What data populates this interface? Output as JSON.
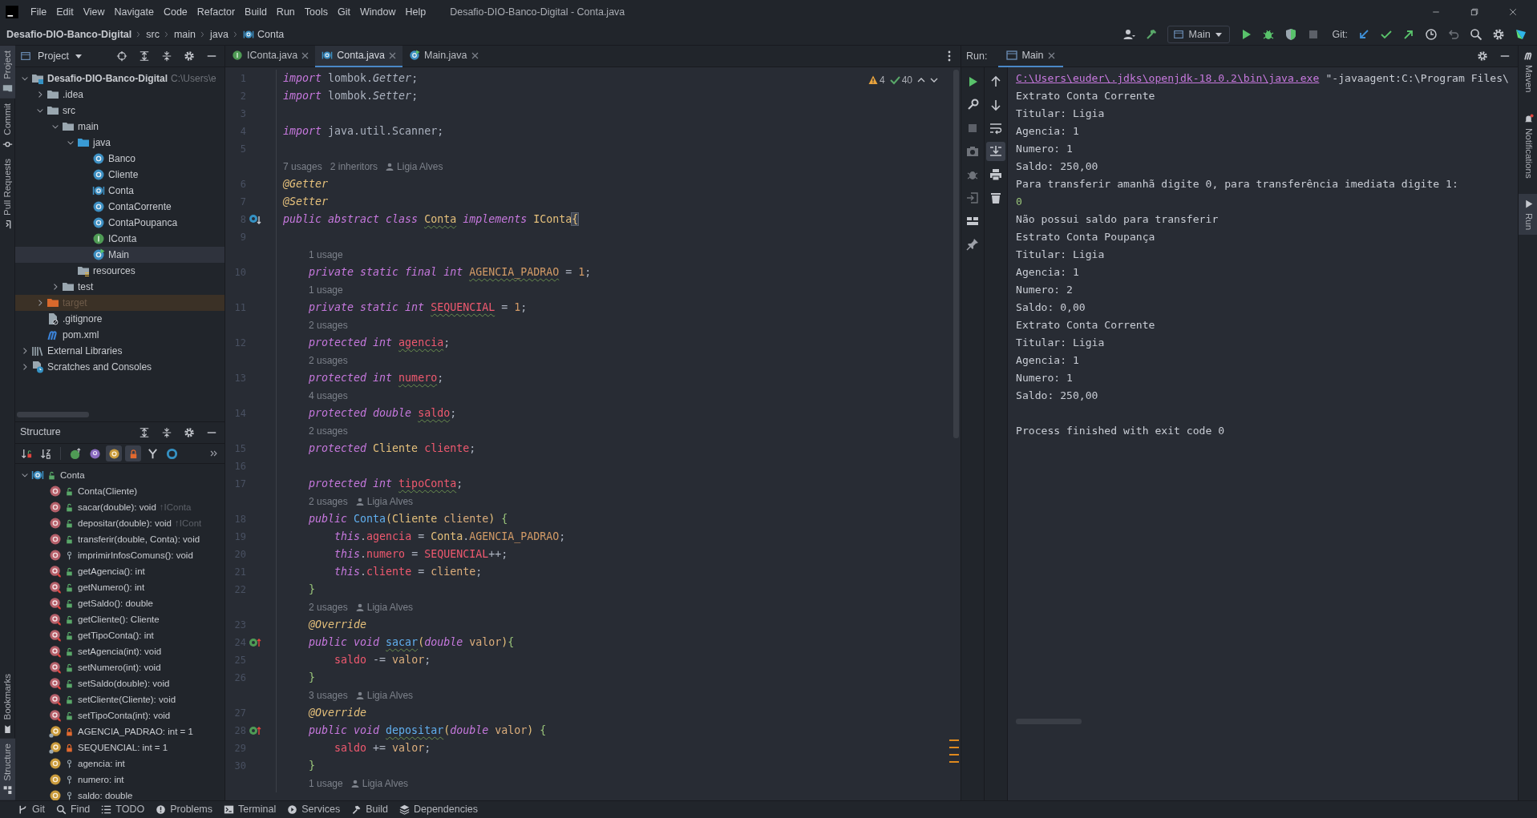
{
  "window": {
    "title": "Desafio-DIO-Banco-Digital - Conta.java"
  },
  "menu": [
    "File",
    "Edit",
    "View",
    "Navigate",
    "Code",
    "Refactor",
    "Build",
    "Run",
    "Tools",
    "Git",
    "Window",
    "Help"
  ],
  "breadcrumb": [
    {
      "label": "Desafio-DIO-Banco-Digital",
      "kind": "project"
    },
    {
      "label": "src",
      "kind": "plain"
    },
    {
      "label": "main",
      "kind": "plain"
    },
    {
      "label": "java",
      "kind": "plain"
    },
    {
      "label": "Conta",
      "kind": "abstract"
    }
  ],
  "toolbar": {
    "run_config": "Main",
    "git_label": "Git:"
  },
  "left_strip": {
    "top": [
      {
        "label": "Project",
        "kind": "project",
        "selected": true
      },
      {
        "label": "Commit",
        "kind": "commit",
        "selected": false
      },
      {
        "label": "Pull Requests",
        "kind": "pullrequests",
        "selected": false
      }
    ],
    "bottom": [
      {
        "label": "Bookmarks",
        "kind": "bookmarks",
        "selected": false
      },
      {
        "label": "Structure",
        "kind": "structure",
        "selected": true
      }
    ]
  },
  "project": {
    "title": "Project",
    "tree": [
      {
        "label": "Desafio-DIO-Banco-Digital",
        "kind": "module",
        "note": "C:\\Users\\e",
        "expanded": true,
        "selected": false,
        "children": [
          {
            "label": ".idea",
            "kind": "folder",
            "expanded": false,
            "selected": false
          },
          {
            "label": "src",
            "kind": "folder",
            "expanded": true,
            "selected": false,
            "children": [
              {
                "label": "main",
                "kind": "folder",
                "expanded": true,
                "selected": false,
                "children": [
                  {
                    "label": "java",
                    "kind": "source",
                    "expanded": true,
                    "selected": false,
                    "children": [
                      {
                        "label": "Banco",
                        "kind": "class",
                        "selected": false
                      },
                      {
                        "label": "Cliente",
                        "kind": "class",
                        "selected": false
                      },
                      {
                        "label": "Conta",
                        "kind": "abstract",
                        "selected": false
                      },
                      {
                        "label": "ContaCorrente",
                        "kind": "class",
                        "selected": false
                      },
                      {
                        "label": "ContaPoupanca",
                        "kind": "class",
                        "selected": false
                      },
                      {
                        "label": "IConta",
                        "kind": "interface",
                        "selected": false
                      },
                      {
                        "label": "Main",
                        "kind": "main",
                        "selected": true
                      }
                    ]
                  },
                  {
                    "label": "resources",
                    "kind": "resources",
                    "selected": false
                  }
                ]
              },
              {
                "label": "test",
                "kind": "folder",
                "expanded": false,
                "selected": false
              }
            ]
          },
          {
            "label": "target",
            "kind": "excluded",
            "expanded": false,
            "selected": false
          },
          {
            "label": ".gitignore",
            "kind": "ignore",
            "selected": false
          },
          {
            "label": "pom.xml",
            "kind": "maven",
            "selected": false
          }
        ]
      },
      {
        "label": "External Libraries",
        "kind": "libraries",
        "expanded": false,
        "selected": false
      },
      {
        "label": "Scratches and Consoles",
        "kind": "scratches",
        "expanded": false,
        "selected": false
      }
    ]
  },
  "structure": {
    "title": "Structure",
    "toolbar": [
      {
        "kind": "visibility",
        "on": false
      },
      {
        "kind": "alpha",
        "on": false
      },
      {
        "kind": "inherited",
        "on": false
      },
      {
        "kind": "properties",
        "on": false
      },
      {
        "kind": "fields",
        "on": true
      },
      {
        "kind": "nonpublic",
        "on": true
      },
      {
        "kind": "lambdas",
        "on": false
      },
      {
        "kind": "anonymous",
        "on": false
      }
    ],
    "tree": [
      {
        "label": "Conta",
        "kind": "publicabstract",
        "expanded": true,
        "selected": false,
        "children": [
          {
            "label": "Conta(Cliente)",
            "kind": "publicmethod",
            "selected": false
          },
          {
            "label": "sacar(double): void",
            "suffix": "↑IConta",
            "kind": "publicmethod",
            "selected": false
          },
          {
            "label": "depositar(double): void",
            "suffix": "↑ICont",
            "kind": "publicmethod",
            "selected": false
          },
          {
            "label": "transferir(double, Conta): void",
            "kind": "publicmethod",
            "selected": false
          },
          {
            "label": "imprimirInfosComuns(): void",
            "kind": "protectedmethod",
            "selected": false
          },
          {
            "label": "getAgencia(): int",
            "kind": "publiclombok",
            "selected": false
          },
          {
            "label": "getNumero(): int",
            "kind": "publiclombok",
            "selected": false
          },
          {
            "label": "getSaldo(): double",
            "kind": "publiclombok",
            "selected": false
          },
          {
            "label": "getCliente(): Cliente",
            "kind": "publiclombok",
            "selected": false
          },
          {
            "label": "getTipoConta(): int",
            "kind": "publiclombok",
            "selected": false
          },
          {
            "label": "setAgencia(int): void",
            "kind": "publiclombok",
            "selected": false
          },
          {
            "label": "setNumero(int): void",
            "kind": "publiclombok",
            "selected": false
          },
          {
            "label": "setSaldo(double): void",
            "kind": "publiclombok",
            "selected": false
          },
          {
            "label": "setCliente(Cliente): void",
            "kind": "publiclombok",
            "selected": false
          },
          {
            "label": "setTipoConta(int): void",
            "kind": "publiclombok",
            "selected": false
          },
          {
            "label": "AGENCIA_PADRAO: int = 1",
            "kind": "privatestatic",
            "selected": false
          },
          {
            "label": "SEQUENCIAL: int = 1",
            "kind": "privatestatic",
            "selected": false
          },
          {
            "label": "agencia: int",
            "kind": "protectedfield",
            "selected": false
          },
          {
            "label": "numero: int",
            "kind": "protectedfield",
            "selected": false
          },
          {
            "label": "saldo: double",
            "kind": "protectedfield",
            "selected": false
          }
        ]
      }
    ]
  },
  "editor": {
    "tabs": [
      {
        "label": "IConta.java",
        "kind": "interface",
        "selected": false
      },
      {
        "label": "Conta.java",
        "kind": "abstract",
        "selected": true
      },
      {
        "label": "Main.java",
        "kind": "main",
        "selected": false
      }
    ],
    "inspection": {
      "warnings": "4",
      "weak_warnings": "40"
    },
    "lines": [
      {
        "kind": "code",
        "number": "1",
        "tokens": [
          {
            "kind": "kw",
            "text": "import"
          },
          {
            "kind": "txt",
            "text": " lombok."
          },
          {
            "kind": "it",
            "text": "Getter"
          },
          {
            "kind": "txt",
            "text": ";"
          }
        ]
      },
      {
        "kind": "code",
        "number": "2",
        "tokens": [
          {
            "kind": "kw",
            "text": "import"
          },
          {
            "kind": "txt",
            "text": " lombok."
          },
          {
            "kind": "it",
            "text": "Setter"
          },
          {
            "kind": "txt",
            "text": ";"
          }
        ]
      },
      {
        "kind": "code",
        "number": "3"
      },
      {
        "kind": "code",
        "number": "4",
        "tokens": [
          {
            "kind": "kw",
            "text": "import"
          },
          {
            "kind": "txt",
            "text": " java.util.Scanner;"
          }
        ]
      },
      {
        "kind": "code",
        "number": "5"
      },
      {
        "kind": "hint",
        "hints": [
          "7 usages",
          "2 inheritors"
        ],
        "author": "Ligia Alves"
      },
      {
        "kind": "code",
        "number": "6",
        "tokens": [
          {
            "kind": "ann",
            "text": "@Getter"
          }
        ]
      },
      {
        "kind": "code",
        "number": "7",
        "tokens": [
          {
            "kind": "ann",
            "text": "@Setter"
          }
        ]
      },
      {
        "kind": "code",
        "number": "8",
        "implemented": true,
        "tokens": [
          {
            "kind": "kw",
            "text": "public abstract class "
          },
          {
            "kind": "clsw",
            "text": "Conta"
          },
          {
            "kind": "kw",
            "text": " implements "
          },
          {
            "kind": "cls",
            "text": "IConta"
          },
          {
            "kind": "brh",
            "text": "{"
          }
        ]
      },
      {
        "kind": "code",
        "number": "9"
      },
      {
        "kind": "hint",
        "hints": [
          "1 usage"
        ]
      },
      {
        "kind": "code",
        "number": "10",
        "tokens": [
          {
            "kind": "kw",
            "text": "    private static final int "
          },
          {
            "kind": "cstw",
            "text": "AGENCIA_PADRAO"
          },
          {
            "kind": "txt",
            "text": " = "
          },
          {
            "kind": "num",
            "text": "1"
          },
          {
            "kind": "txt",
            "text": ";"
          }
        ]
      },
      {
        "kind": "hint",
        "hints": [
          "1 usage"
        ]
      },
      {
        "kind": "code",
        "number": "11",
        "tokens": [
          {
            "kind": "kw",
            "text": "    private static int "
          },
          {
            "kind": "fldw",
            "text": "SEQUENCIAL"
          },
          {
            "kind": "txt",
            "text": " = "
          },
          {
            "kind": "num",
            "text": "1"
          },
          {
            "kind": "txt",
            "text": ";"
          }
        ]
      },
      {
        "kind": "hint",
        "hints": [
          "2 usages"
        ]
      },
      {
        "kind": "code",
        "number": "12",
        "tokens": [
          {
            "kind": "kw",
            "text": "    protected int "
          },
          {
            "kind": "fldw",
            "text": "agencia"
          },
          {
            "kind": "txt",
            "text": ";"
          }
        ]
      },
      {
        "kind": "hint",
        "hints": [
          "2 usages"
        ]
      },
      {
        "kind": "code",
        "number": "13",
        "tokens": [
          {
            "kind": "kw",
            "text": "    protected int "
          },
          {
            "kind": "fldw",
            "text": "numero"
          },
          {
            "kind": "txt",
            "text": ";"
          }
        ]
      },
      {
        "kind": "hint",
        "hints": [
          "4 usages"
        ]
      },
      {
        "kind": "code",
        "number": "14",
        "tokens": [
          {
            "kind": "kw",
            "text": "    protected double "
          },
          {
            "kind": "fldw",
            "text": "saldo"
          },
          {
            "kind": "txt",
            "text": ";"
          }
        ]
      },
      {
        "kind": "hint",
        "hints": [
          "2 usages"
        ]
      },
      {
        "kind": "code",
        "number": "15",
        "tokens": [
          {
            "kind": "kw",
            "text": "    protected "
          },
          {
            "kind": "cls",
            "text": "Cliente "
          },
          {
            "kind": "fld",
            "text": "cliente"
          },
          {
            "kind": "txt",
            "text": ";"
          }
        ]
      },
      {
        "kind": "code",
        "number": "16"
      },
      {
        "kind": "code",
        "number": "17",
        "tokens": [
          {
            "kind": "kw",
            "text": "    protected int "
          },
          {
            "kind": "fldw",
            "text": "tipoConta"
          },
          {
            "kind": "txt",
            "text": ";"
          }
        ]
      },
      {
        "kind": "hint",
        "hints": [
          "2 usages"
        ],
        "author": "Ligia Alves"
      },
      {
        "kind": "code",
        "number": "18",
        "tokens": [
          {
            "kind": "kw",
            "text": "    public "
          },
          {
            "kind": "fn",
            "text": "Conta"
          },
          {
            "kind": "par",
            "text": "("
          },
          {
            "kind": "cls",
            "text": "Cliente "
          },
          {
            "kind": "prm",
            "text": "cliente"
          },
          {
            "kind": "par",
            "text": ")"
          },
          {
            "kind": "brc",
            "text": " {"
          }
        ]
      },
      {
        "kind": "code",
        "number": "19",
        "tokens": [
          {
            "kind": "kw",
            "text": "        this"
          },
          {
            "kind": "txt",
            "text": "."
          },
          {
            "kind": "fld",
            "text": "agencia"
          },
          {
            "kind": "txt",
            "text": " = "
          },
          {
            "kind": "cls",
            "text": "Conta"
          },
          {
            "kind": "txt",
            "text": "."
          },
          {
            "kind": "cst",
            "text": "AGENCIA_PADRAO"
          },
          {
            "kind": "txt",
            "text": ";"
          }
        ]
      },
      {
        "kind": "code",
        "number": "20",
        "tokens": [
          {
            "kind": "kw",
            "text": "        this"
          },
          {
            "kind": "txt",
            "text": "."
          },
          {
            "kind": "fld",
            "text": "numero"
          },
          {
            "kind": "txt",
            "text": " = "
          },
          {
            "kind": "fld",
            "text": "SEQUENCIAL"
          },
          {
            "kind": "txt",
            "text": "++;"
          }
        ]
      },
      {
        "kind": "code",
        "number": "21",
        "tokens": [
          {
            "kind": "kw",
            "text": "        this"
          },
          {
            "kind": "txt",
            "text": "."
          },
          {
            "kind": "fld",
            "text": "cliente"
          },
          {
            "kind": "txt",
            "text": " = "
          },
          {
            "kind": "prm",
            "text": "cliente"
          },
          {
            "kind": "txt",
            "text": ";"
          }
        ]
      },
      {
        "kind": "code",
        "number": "22",
        "tokens": [
          {
            "kind": "brc",
            "text": "    }"
          }
        ]
      },
      {
        "kind": "hint",
        "hints": [
          "2 usages"
        ],
        "author": "Ligia Alves"
      },
      {
        "kind": "code",
        "number": "23",
        "tokens": [
          {
            "kind": "ann",
            "text": "    @Override"
          }
        ]
      },
      {
        "kind": "code",
        "number": "24",
        "overrides": true,
        "tokens": [
          {
            "kind": "kw",
            "text": "    public void "
          },
          {
            "kind": "fnw",
            "text": "sacar"
          },
          {
            "kind": "par",
            "text": "("
          },
          {
            "kind": "kw",
            "text": "double "
          },
          {
            "kind": "prm",
            "text": "valor"
          },
          {
            "kind": "par",
            "text": ")"
          },
          {
            "kind": "brc",
            "text": "{"
          }
        ]
      },
      {
        "kind": "code",
        "number": "25",
        "tokens": [
          {
            "kind": "fld",
            "text": "        saldo"
          },
          {
            "kind": "txt",
            "text": " -= "
          },
          {
            "kind": "prm",
            "text": "valor"
          },
          {
            "kind": "txt",
            "text": ";"
          }
        ]
      },
      {
        "kind": "code",
        "number": "26",
        "tokens": [
          {
            "kind": "brc",
            "text": "    }"
          }
        ]
      },
      {
        "kind": "hint",
        "hints": [
          "3 usages"
        ],
        "author": "Ligia Alves"
      },
      {
        "kind": "code",
        "number": "27",
        "tokens": [
          {
            "kind": "ann",
            "text": "    @Override"
          }
        ]
      },
      {
        "kind": "code",
        "number": "28",
        "overrides": true,
        "tokens": [
          {
            "kind": "kw",
            "text": "    public void "
          },
          {
            "kind": "fnw",
            "text": "depositar"
          },
          {
            "kind": "par",
            "text": "("
          },
          {
            "kind": "kw",
            "text": "double "
          },
          {
            "kind": "prm",
            "text": "valor"
          },
          {
            "kind": "par",
            "text": ")"
          },
          {
            "kind": "brc",
            "text": " {"
          }
        ]
      },
      {
        "kind": "code",
        "number": "29",
        "tokens": [
          {
            "kind": "fld",
            "text": "        saldo"
          },
          {
            "kind": "txt",
            "text": " += "
          },
          {
            "kind": "prm",
            "text": "valor"
          },
          {
            "kind": "txt",
            "text": ";"
          }
        ]
      },
      {
        "kind": "code",
        "number": "30",
        "tokens": [
          {
            "kind": "brc",
            "text": "    }"
          }
        ]
      },
      {
        "kind": "hint",
        "hints": [
          "1 usage"
        ],
        "author": "Ligia Alves"
      }
    ]
  },
  "run": {
    "label": "Run:",
    "tab": "Main",
    "scroll_to_end": true,
    "output": [
      {
        "kind": "command",
        "link": "C:\\Users\\euder\\.jdks\\openjdk-18.0.2\\bin\\java.exe",
        "text": "\"-javaagent:C:\\Program Files\\"
      },
      {
        "kind": "out",
        "text": "Extrato Conta Corrente"
      },
      {
        "kind": "out",
        "text": "Titular: Ligia"
      },
      {
        "kind": "out",
        "text": "Agencia: 1"
      },
      {
        "kind": "out",
        "text": "Numero: 1"
      },
      {
        "kind": "out",
        "text": "Saldo: 250,00"
      },
      {
        "kind": "out",
        "text": "Para transferir amanhã digite 0, para transferência imediata digite 1:"
      },
      {
        "kind": "input",
        "text": "0"
      },
      {
        "kind": "out",
        "text": "Não possui saldo para transferir"
      },
      {
        "kind": "out",
        "text": "Estrato Conta Poupança"
      },
      {
        "kind": "out",
        "text": "Titular: Ligia"
      },
      {
        "kind": "out",
        "text": "Agencia: 1"
      },
      {
        "kind": "out",
        "text": "Numero: 2"
      },
      {
        "kind": "out",
        "text": "Saldo: 0,00"
      },
      {
        "kind": "out",
        "text": "Extrato Conta Corrente"
      },
      {
        "kind": "out",
        "text": "Titular: Ligia"
      },
      {
        "kind": "out",
        "text": "Agencia: 1"
      },
      {
        "kind": "out",
        "text": "Numero: 1"
      },
      {
        "kind": "out",
        "text": "Saldo: 250,00"
      },
      {
        "kind": "blank"
      },
      {
        "kind": "out",
        "text": "Process finished with exit code 0"
      }
    ]
  },
  "right_strip": [
    {
      "label": "Maven",
      "kind": "maven",
      "selected": false
    },
    {
      "label": "Notifications",
      "kind": "notifications",
      "selected": false
    },
    {
      "label": "Run",
      "kind": "run",
      "selected": true
    }
  ],
  "status_bar": [
    {
      "label": "Git",
      "kind": "git"
    },
    {
      "label": "Find",
      "kind": "find"
    },
    {
      "label": "TODO",
      "kind": "todo"
    },
    {
      "label": "Problems",
      "kind": "problems"
    },
    {
      "label": "Terminal",
      "kind": "terminal"
    },
    {
      "label": "Services",
      "kind": "services"
    },
    {
      "label": "Build",
      "kind": "build"
    },
    {
      "label": "Dependencies",
      "kind": "dependencies"
    }
  ]
}
